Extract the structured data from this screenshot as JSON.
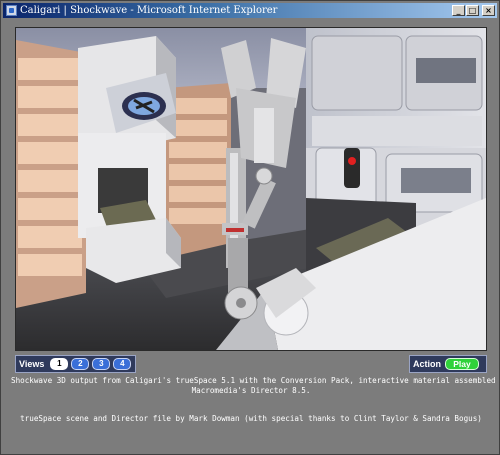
{
  "window": {
    "title": "Caligari | Shockwave - Microsoft Internet Explorer",
    "buttons": {
      "minimize": "_",
      "maximize": "□",
      "close": "×"
    }
  },
  "scene": {
    "description_icon": "3d-scene",
    "colors": {
      "floor": "#3a3a3c",
      "wall_panel": "#d8d8dc",
      "wood_panel": "#e8c4a8",
      "monitor": "#b8bcc4",
      "robot_arm": "#c8c8c8",
      "eye_red": "#e02020"
    }
  },
  "controls": {
    "views_label": "Views",
    "view_buttons": [
      "1",
      "2",
      "3",
      "4"
    ],
    "active_view": "1",
    "action_label": "Action",
    "play_label": "Play",
    "play_color": "#2fd23a"
  },
  "caption": {
    "line1": "Shockwave 3D output from Caligari's trueSpace 5.1 with the Conversion Pack, interactive material assembled in",
    "line2": "Macromedia's Director 8.5.",
    "line3": "trueSpace scene and Director file by Mark Dowman (with special thanks to Clint Taylor & Sandra Bogus)"
  }
}
